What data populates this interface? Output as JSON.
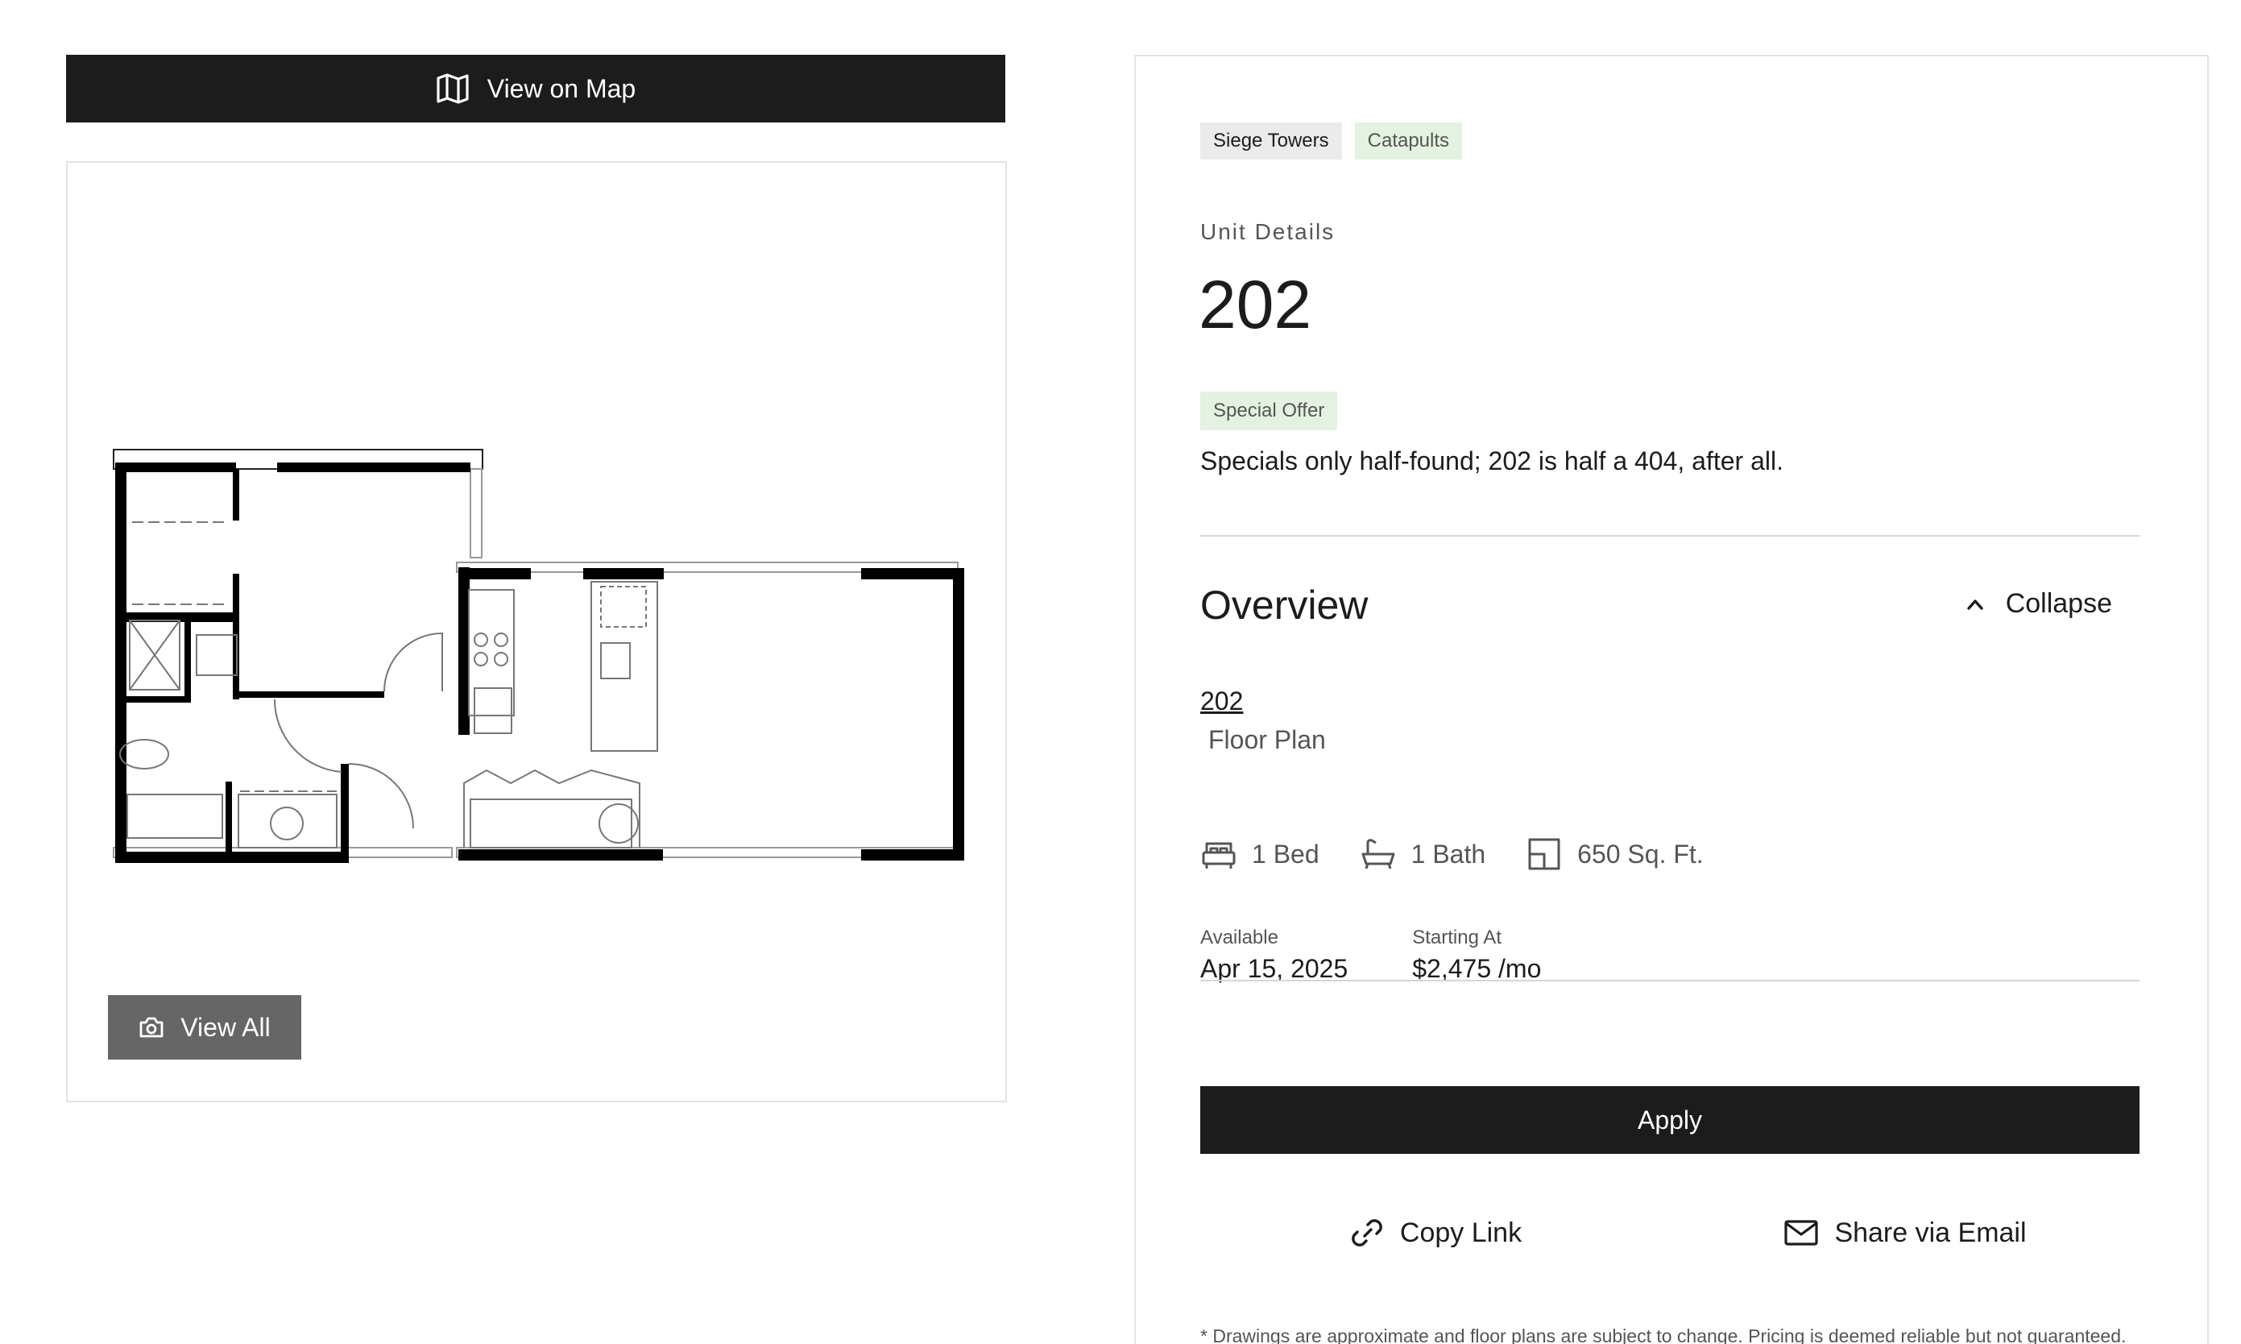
{
  "left": {
    "map_button_label": "View on Map",
    "view_all_label": "View All"
  },
  "detail": {
    "tags": [
      "Siege Towers",
      "Catapults"
    ],
    "eyebrow": "Unit Details",
    "unit_number": "202",
    "offer_badge": "Special Offer",
    "offer_text": "Specials only half-found; 202 is half a 404, after all.",
    "overview_heading": "Overview",
    "collapse_label": "Collapse",
    "plan_link": "202",
    "plan_label": "Floor Plan",
    "specs": {
      "bed": "1 Bed",
      "bath": "1 Bath",
      "area": "650 Sq. Ft."
    },
    "available_label": "Available",
    "available_value": "Apr 15, 2025",
    "price_label": "Starting At",
    "price_value": "$2,475 /mo",
    "apply_label": "Apply",
    "copy_link_label": "Copy Link",
    "share_email_label": "Share via Email",
    "disclaimer": "* Drawings are approximate and floor plans are subject to change. Pricing is deemed reliable but not guaranteed."
  }
}
